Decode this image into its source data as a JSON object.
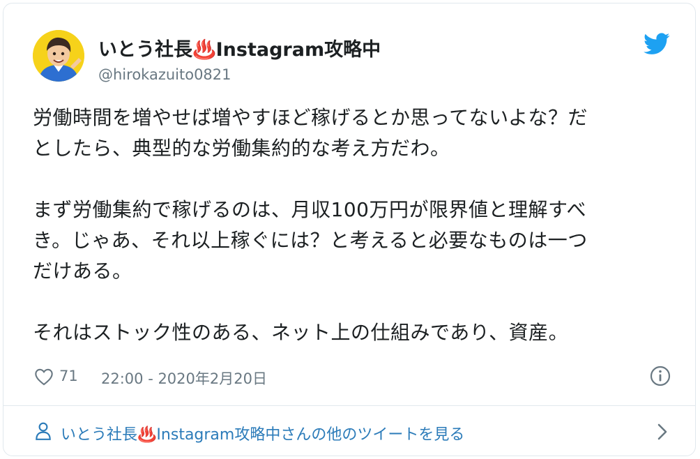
{
  "author": {
    "name": "いとう社長",
    "emoji": "♨️",
    "name_suffix": "Instagram攻略中",
    "handle": "@hirokazuito0821"
  },
  "tweet": {
    "paragraphs": [
      [
        "労働時間を増やせば増やすほど稼げるとか思ってないよな？だ",
        "としたら、典型的な労働集約的な考え方だわ。"
      ],
      [
        "まず労働集約で稼げるのは、月収100万円が限界値と理解すべ",
        "き。じゃあ、それ以上稼ぐには？と考えると必要なものは一つ",
        "だけある。"
      ],
      [
        "それはストック性のある、ネット上の仕組みであり、資産。"
      ]
    ]
  },
  "meta": {
    "likes": "71",
    "timestamp": "22:00 - 2020年2月20日"
  },
  "footer": {
    "prefix": "いとう社長",
    "emoji": "♨️",
    "suffix": "Instagram攻略中さんの他のツイートを見る"
  },
  "colors": {
    "twitter_blue": "#1da1f2",
    "link_blue": "#2b7bb9",
    "secondary_text": "#697882",
    "border": "#e1e8ed",
    "avatar_bg": "#f6d21a"
  },
  "icons": {
    "brand": "twitter-bird-icon",
    "like": "heart-outline-icon",
    "info": "info-circle-icon",
    "profile": "person-outline-icon",
    "more": "chevron-right-icon"
  }
}
